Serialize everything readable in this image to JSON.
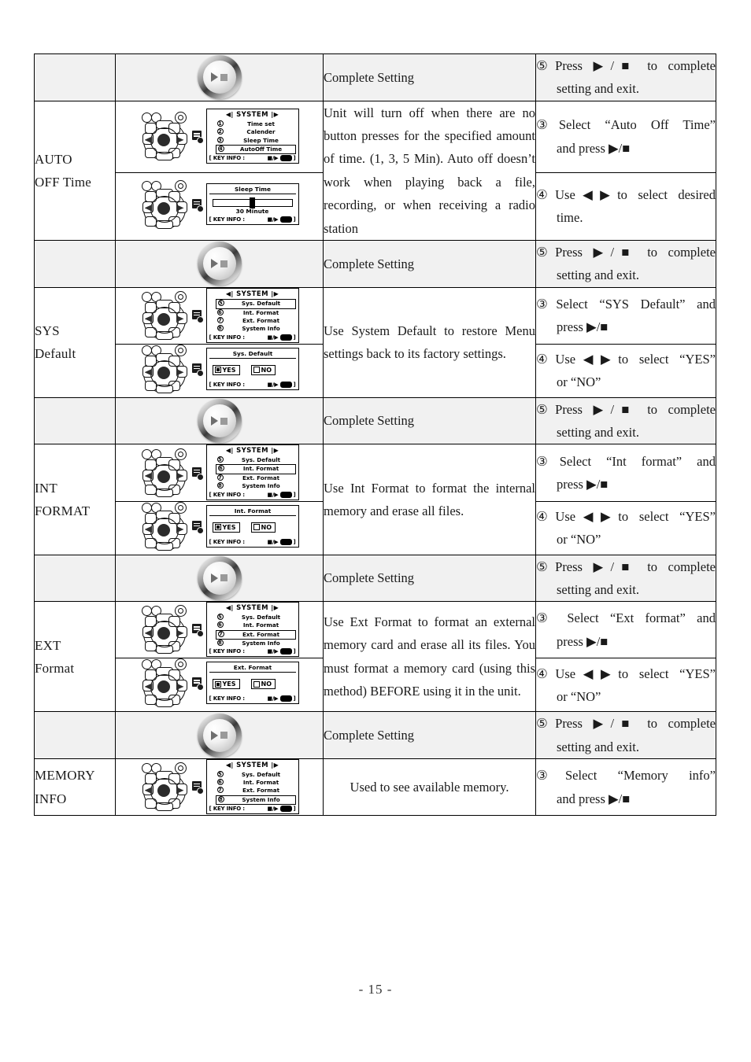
{
  "document": {
    "page_number": "- 15 -"
  },
  "table": {
    "rows": [
      {
        "id": "complete-setting-1",
        "type": "complete",
        "label": "",
        "figure": "play-stop-button",
        "description": "Complete Setting",
        "steps": [
          {
            "num": "⑤",
            "text": "Press ▶/■ to complete",
            "cont": "setting and exit."
          }
        ]
      },
      {
        "id": "auto-off-time",
        "type": "feature",
        "label_line1": "AUTO",
        "label_line2": "OFF Time",
        "description": "Unit will turn off when there are no button presses for the specified amount of time. (1, 3, 5 Min). Auto off doesn’t work when playing back a file, recording, or when receiving a radio station",
        "screens": [
          {
            "kind": "menu",
            "title": "SYSTEM",
            "items": [
              {
                "num": "①",
                "label": "Time set",
                "selected": false
              },
              {
                "num": "②",
                "label": "Calender",
                "selected": false
              },
              {
                "num": "③",
                "label": "Sleep Time",
                "selected": false
              },
              {
                "num": "④",
                "label": "AutoOff Time",
                "selected": true
              }
            ],
            "footer_label": "[ KEY INFO :",
            "footer_keys": "■/▶"
          },
          {
            "kind": "slider",
            "header": "Sleep Time",
            "value": "30 Minute",
            "footer_label": "[ KEY INFO :",
            "footer_keys": "■/▶"
          }
        ],
        "steps": [
          {
            "num": "③",
            "text": "Select “Auto Off Time”",
            "cont": "and press ▶/■"
          },
          {
            "num": "④",
            "text": "Use◀▶to select desired",
            "cont": "time."
          }
        ]
      },
      {
        "id": "complete-setting-2",
        "type": "complete",
        "label": "",
        "figure": "play-stop-button",
        "description": "Complete Setting",
        "steps": [
          {
            "num": "⑤",
            "text": "Press ▶/■ to complete",
            "cont": "setting and exit."
          }
        ]
      },
      {
        "id": "sys-default",
        "type": "feature",
        "label_line1": "SYS",
        "label_line2": "Default",
        "description": "Use System Default to restore Menu settings back to its factory settings.",
        "screens": [
          {
            "kind": "menu",
            "title": "SYSTEM",
            "items": [
              {
                "num": "⑤",
                "label": "Sys. Default",
                "selected": true
              },
              {
                "num": "⑥",
                "label": "Int. Format",
                "selected": false
              },
              {
                "num": "⑦",
                "label": "Ext. Format",
                "selected": false
              },
              {
                "num": "⑧",
                "label": "System Info",
                "selected": false
              }
            ],
            "footer_label": "[ KEY INFO :",
            "footer_keys": "■/▶"
          },
          {
            "kind": "yesno",
            "header": "Sys. Default",
            "yes_label": "YES",
            "no_label": "NO",
            "selected": "YES",
            "footer_label": "[ KEY INFO :",
            "footer_keys": "■/▶"
          }
        ],
        "steps": [
          {
            "num": "③",
            "text": "Select “SYS Default” and",
            "cont": "press ▶/■"
          },
          {
            "num": "④",
            "text": "Use◀▶to select “YES”",
            "cont": "or “NO”"
          }
        ]
      },
      {
        "id": "complete-setting-3",
        "type": "complete",
        "label": "",
        "figure": "play-stop-button",
        "description": "Complete Setting",
        "steps": [
          {
            "num": "⑤",
            "text": "Press ▶/■ to complete",
            "cont": "setting and exit."
          }
        ]
      },
      {
        "id": "int-format",
        "type": "feature",
        "label_line1": "INT",
        "label_line2": "FORMAT",
        "description": "Use Int Format to format the internal memory and erase all files.",
        "screens": [
          {
            "kind": "menu",
            "title": "SYSTEM",
            "items": [
              {
                "num": "⑤",
                "label": "Sys. Default",
                "selected": false
              },
              {
                "num": "⑥",
                "label": "Int. Format",
                "selected": true
              },
              {
                "num": "⑦",
                "label": "Ext. Format",
                "selected": false
              },
              {
                "num": "⑧",
                "label": "System Info",
                "selected": false
              }
            ],
            "footer_label": "[ KEY INFO :",
            "footer_keys": "■/▶"
          },
          {
            "kind": "yesno",
            "header": "Int. Format",
            "yes_label": "YES",
            "no_label": "NO",
            "selected": "YES",
            "footer_label": "[ KEY INFO :",
            "footer_keys": "■/▶"
          }
        ],
        "steps": [
          {
            "num": "③",
            "text": "Select “Int format” and",
            "cont": "press ▶/■"
          },
          {
            "num": "④",
            "text": "Use◀▶to select “YES”",
            "cont": "or “NO”"
          }
        ]
      },
      {
        "id": "complete-setting-4",
        "type": "complete",
        "label": "",
        "figure": "play-stop-button",
        "description": "Complete Setting",
        "steps": [
          {
            "num": "⑤",
            "text": "Press ▶/■ to complete",
            "cont": "setting and exit."
          }
        ]
      },
      {
        "id": "ext-format",
        "type": "feature",
        "label_line1": "EXT",
        "label_line2": "Format",
        "description": "Use Ext Format to format an external memory card and erase all its files. You must format a memory card (using this method) BEFORE using it in the unit.",
        "screens": [
          {
            "kind": "menu",
            "title": "SYSTEM",
            "items": [
              {
                "num": "⑤",
                "label": "Sys. Default",
                "selected": false
              },
              {
                "num": "⑥",
                "label": "Int. Format",
                "selected": false
              },
              {
                "num": "⑦",
                "label": "Ext. Format",
                "selected": true
              },
              {
                "num": "⑧",
                "label": "System Info",
                "selected": false
              }
            ],
            "footer_label": "[ KEY INFO :",
            "footer_keys": "■/▶"
          },
          {
            "kind": "yesno",
            "header": "Ext. Format",
            "yes_label": "YES",
            "no_label": "NO",
            "selected": "YES",
            "footer_label": "[ KEY INFO :",
            "footer_keys": "■/▶"
          }
        ],
        "steps": [
          {
            "num": "③",
            "text": " Select “Ext format” and",
            "cont": "press ▶/■"
          },
          {
            "num": "④",
            "text": "Use◀▶to select “YES”",
            "cont": "or “NO”"
          }
        ]
      },
      {
        "id": "complete-setting-5",
        "type": "complete",
        "label": "",
        "figure": "play-stop-button",
        "description": "Complete Setting",
        "steps": [
          {
            "num": "⑤",
            "text": "Press ▶/■ to complete",
            "cont": "setting and exit."
          }
        ]
      },
      {
        "id": "memory-info",
        "type": "feature",
        "label_line1": "MEMORY",
        "label_line2": "INFO",
        "description": "Used to see available memory.",
        "screens": [
          {
            "kind": "menu",
            "title": "SYSTEM",
            "items": [
              {
                "num": "⑤",
                "label": "Sys. Default",
                "selected": false
              },
              {
                "num": "⑥",
                "label": "Int. Format",
                "selected": false
              },
              {
                "num": "⑦",
                "label": "Ext. Format",
                "selected": false
              },
              {
                "num": "⑧",
                "label": "System Info",
                "selected": true
              }
            ],
            "footer_label": "[ KEY INFO :",
            "footer_keys": "■/▶"
          }
        ],
        "steps": [
          {
            "num": "③",
            "text": "Select “Memory info”",
            "cont": "and press ▶/■"
          }
        ]
      }
    ]
  }
}
